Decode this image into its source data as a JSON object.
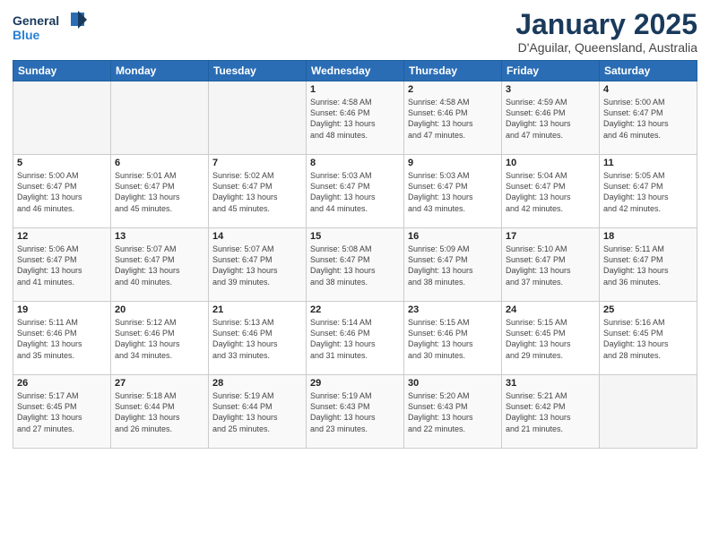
{
  "header": {
    "logo_line1": "General",
    "logo_line2": "Blue",
    "title": "January 2025",
    "subtitle": "D'Aguilar, Queensland, Australia"
  },
  "weekdays": [
    "Sunday",
    "Monday",
    "Tuesday",
    "Wednesday",
    "Thursday",
    "Friday",
    "Saturday"
  ],
  "weeks": [
    [
      {
        "day": "",
        "info": ""
      },
      {
        "day": "",
        "info": ""
      },
      {
        "day": "",
        "info": ""
      },
      {
        "day": "1",
        "info": "Sunrise: 4:58 AM\nSunset: 6:46 PM\nDaylight: 13 hours\nand 48 minutes."
      },
      {
        "day": "2",
        "info": "Sunrise: 4:58 AM\nSunset: 6:46 PM\nDaylight: 13 hours\nand 47 minutes."
      },
      {
        "day": "3",
        "info": "Sunrise: 4:59 AM\nSunset: 6:46 PM\nDaylight: 13 hours\nand 47 minutes."
      },
      {
        "day": "4",
        "info": "Sunrise: 5:00 AM\nSunset: 6:47 PM\nDaylight: 13 hours\nand 46 minutes."
      }
    ],
    [
      {
        "day": "5",
        "info": "Sunrise: 5:00 AM\nSunset: 6:47 PM\nDaylight: 13 hours\nand 46 minutes."
      },
      {
        "day": "6",
        "info": "Sunrise: 5:01 AM\nSunset: 6:47 PM\nDaylight: 13 hours\nand 45 minutes."
      },
      {
        "day": "7",
        "info": "Sunrise: 5:02 AM\nSunset: 6:47 PM\nDaylight: 13 hours\nand 45 minutes."
      },
      {
        "day": "8",
        "info": "Sunrise: 5:03 AM\nSunset: 6:47 PM\nDaylight: 13 hours\nand 44 minutes."
      },
      {
        "day": "9",
        "info": "Sunrise: 5:03 AM\nSunset: 6:47 PM\nDaylight: 13 hours\nand 43 minutes."
      },
      {
        "day": "10",
        "info": "Sunrise: 5:04 AM\nSunset: 6:47 PM\nDaylight: 13 hours\nand 42 minutes."
      },
      {
        "day": "11",
        "info": "Sunrise: 5:05 AM\nSunset: 6:47 PM\nDaylight: 13 hours\nand 42 minutes."
      }
    ],
    [
      {
        "day": "12",
        "info": "Sunrise: 5:06 AM\nSunset: 6:47 PM\nDaylight: 13 hours\nand 41 minutes."
      },
      {
        "day": "13",
        "info": "Sunrise: 5:07 AM\nSunset: 6:47 PM\nDaylight: 13 hours\nand 40 minutes."
      },
      {
        "day": "14",
        "info": "Sunrise: 5:07 AM\nSunset: 6:47 PM\nDaylight: 13 hours\nand 39 minutes."
      },
      {
        "day": "15",
        "info": "Sunrise: 5:08 AM\nSunset: 6:47 PM\nDaylight: 13 hours\nand 38 minutes."
      },
      {
        "day": "16",
        "info": "Sunrise: 5:09 AM\nSunset: 6:47 PM\nDaylight: 13 hours\nand 38 minutes."
      },
      {
        "day": "17",
        "info": "Sunrise: 5:10 AM\nSunset: 6:47 PM\nDaylight: 13 hours\nand 37 minutes."
      },
      {
        "day": "18",
        "info": "Sunrise: 5:11 AM\nSunset: 6:47 PM\nDaylight: 13 hours\nand 36 minutes."
      }
    ],
    [
      {
        "day": "19",
        "info": "Sunrise: 5:11 AM\nSunset: 6:46 PM\nDaylight: 13 hours\nand 35 minutes."
      },
      {
        "day": "20",
        "info": "Sunrise: 5:12 AM\nSunset: 6:46 PM\nDaylight: 13 hours\nand 34 minutes."
      },
      {
        "day": "21",
        "info": "Sunrise: 5:13 AM\nSunset: 6:46 PM\nDaylight: 13 hours\nand 33 minutes."
      },
      {
        "day": "22",
        "info": "Sunrise: 5:14 AM\nSunset: 6:46 PM\nDaylight: 13 hours\nand 31 minutes."
      },
      {
        "day": "23",
        "info": "Sunrise: 5:15 AM\nSunset: 6:46 PM\nDaylight: 13 hours\nand 30 minutes."
      },
      {
        "day": "24",
        "info": "Sunrise: 5:15 AM\nSunset: 6:45 PM\nDaylight: 13 hours\nand 29 minutes."
      },
      {
        "day": "25",
        "info": "Sunrise: 5:16 AM\nSunset: 6:45 PM\nDaylight: 13 hours\nand 28 minutes."
      }
    ],
    [
      {
        "day": "26",
        "info": "Sunrise: 5:17 AM\nSunset: 6:45 PM\nDaylight: 13 hours\nand 27 minutes."
      },
      {
        "day": "27",
        "info": "Sunrise: 5:18 AM\nSunset: 6:44 PM\nDaylight: 13 hours\nand 26 minutes."
      },
      {
        "day": "28",
        "info": "Sunrise: 5:19 AM\nSunset: 6:44 PM\nDaylight: 13 hours\nand 25 minutes."
      },
      {
        "day": "29",
        "info": "Sunrise: 5:19 AM\nSunset: 6:43 PM\nDaylight: 13 hours\nand 23 minutes."
      },
      {
        "day": "30",
        "info": "Sunrise: 5:20 AM\nSunset: 6:43 PM\nDaylight: 13 hours\nand 22 minutes."
      },
      {
        "day": "31",
        "info": "Sunrise: 5:21 AM\nSunset: 6:42 PM\nDaylight: 13 hours\nand 21 minutes."
      },
      {
        "day": "",
        "info": ""
      }
    ]
  ]
}
